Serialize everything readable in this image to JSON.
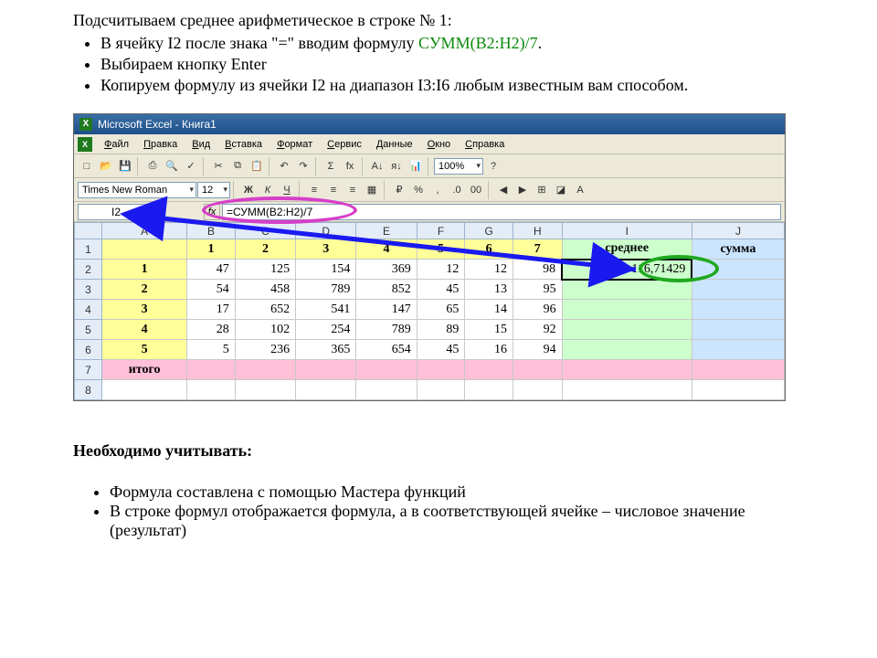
{
  "intro": {
    "heading": "Подсчитываем среднее арифметическое в строке № 1:",
    "bullets": [
      {
        "pre": "В ячейку I2 после знака \"=\" вводим формулу ",
        "green": "СУММ(В2:Н2)/7",
        "post": "."
      },
      {
        "pre": "Выбираем кнопку Enter",
        "green": "",
        "post": ""
      },
      {
        "pre": "Копируем формулу из ячейки I2 на диапазон I3:I6 любым известным вам способом.",
        "green": "",
        "post": ""
      }
    ]
  },
  "excel": {
    "title": "Microsoft Excel - Книга1",
    "menus": [
      "Файл",
      "Правка",
      "Вид",
      "Вставка",
      "Формат",
      "Сервис",
      "Данные",
      "Окно",
      "Справка"
    ],
    "font_name": "Times New Roman",
    "font_size": "12",
    "zoom": "100%",
    "namebox": "I2",
    "fx_label": "fx",
    "formula": "=СУММ(B2:H2)/7",
    "col_headers": [
      "A",
      "B",
      "C",
      "D",
      "E",
      "F",
      "G",
      "H",
      "I",
      "J"
    ],
    "row_headers": [
      "1",
      "2",
      "3",
      "4",
      "5",
      "6",
      "7",
      "8"
    ],
    "header_row": [
      "",
      "1",
      "2",
      "3",
      "4",
      "5",
      "6",
      "7",
      "среднее",
      "сумма"
    ],
    "rows": [
      {
        "a": "1",
        "b": "47",
        "c": "125",
        "d": "154",
        "e": "369",
        "f": "12",
        "g": "12",
        "h": "98",
        "i": "116,71429",
        "j": ""
      },
      {
        "a": "2",
        "b": "54",
        "c": "458",
        "d": "789",
        "e": "852",
        "f": "45",
        "g": "13",
        "h": "95",
        "i": "",
        "j": ""
      },
      {
        "a": "3",
        "b": "17",
        "c": "652",
        "d": "541",
        "e": "147",
        "f": "65",
        "g": "14",
        "h": "96",
        "i": "",
        "j": ""
      },
      {
        "a": "4",
        "b": "28",
        "c": "102",
        "d": "254",
        "e": "789",
        "f": "89",
        "g": "15",
        "h": "92",
        "i": "",
        "j": ""
      },
      {
        "a": "5",
        "b": "5",
        "c": "236",
        "d": "365",
        "e": "654",
        "f": "45",
        "g": "16",
        "h": "94",
        "i": "",
        "j": ""
      }
    ],
    "itogo": "итого"
  },
  "outro": {
    "heading": "Необходимо учитывать:",
    "bullets": [
      "Формула составлена с помощью Мастера функций",
      "В строке формул отображается формула, а в соответствующей ячейке – числовое значение (результат)"
    ]
  },
  "icons": {
    "new": "□",
    "open": "📂",
    "save": "💾",
    "print": "⎙",
    "preview": "🔍",
    "spell": "✓",
    "cut": "✂",
    "copy": "⧉",
    "paste": "📋",
    "undo": "↶",
    "redo": "↷",
    "sum": "Σ",
    "fx": "fx",
    "sort_a": "A↓",
    "sort_d": "я↓",
    "chart": "📊",
    "help": "?",
    "bold": "Ж",
    "italic": "К",
    "underline": "Ч",
    "al": "≡",
    "ac": "≡",
    "ar": "≡",
    "merge": "▦",
    "cur": "₽",
    "pct": "%",
    "comma": ",",
    "dec_inc": ".0",
    "dec_dec": "00",
    "indent_l": "◀",
    "indent_r": "▶",
    "borders": "⊞",
    "fill": "◪",
    "font_c": "A"
  }
}
